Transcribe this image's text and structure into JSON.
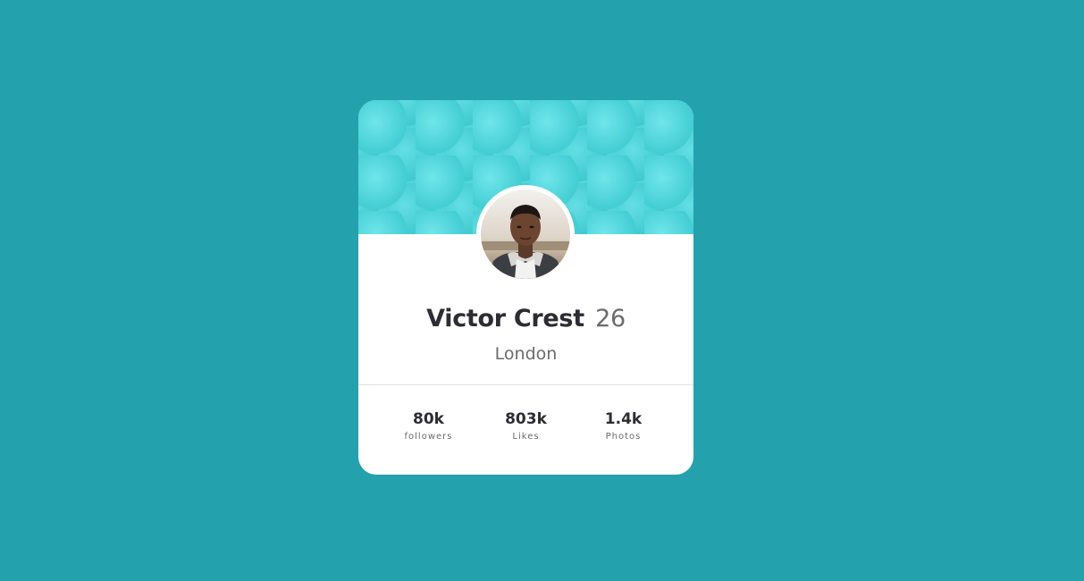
{
  "profile": {
    "name": "Victor Crest",
    "age": "26",
    "city": "London"
  },
  "stats": [
    {
      "value": "80k",
      "label": "followers"
    },
    {
      "value": "803k",
      "label": "Likes"
    },
    {
      "value": "1.4k",
      "label": "Photos"
    }
  ],
  "colors": {
    "background": "#23A2AE",
    "banner": "#52D6DB",
    "card": "#FFFFFF",
    "text_primary": "#2C2C33",
    "text_secondary": "#6B6B6E"
  }
}
